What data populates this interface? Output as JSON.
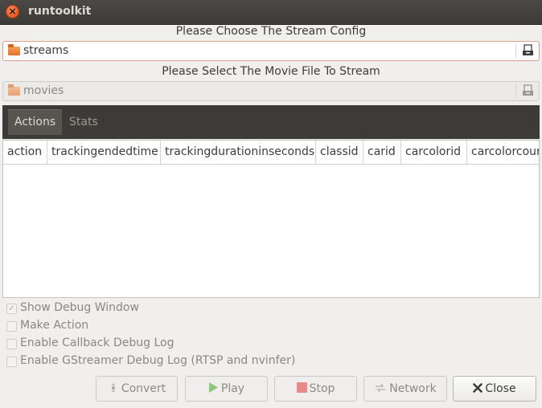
{
  "window": {
    "title": "runtoolkit",
    "close_glyph": "×"
  },
  "config": {
    "caption": "Please Choose The Stream Config",
    "chooser_label": "streams",
    "chooser_icon": "folder-icon",
    "action_icon": "document-open-icon"
  },
  "movie": {
    "caption": "Please Select The Movie File To Stream",
    "chooser_label": "movies",
    "chooser_icon": "folder-icon",
    "action_icon": "document-open-icon"
  },
  "tabs": [
    {
      "label": "Actions",
      "active": true
    },
    {
      "label": "Stats",
      "active": false
    }
  ],
  "table": {
    "columns": [
      "action",
      "trackingendedtime",
      "trackingdurationinseconds",
      "classid",
      "carid",
      "carcolorid",
      "carcolorcour"
    ],
    "rows": []
  },
  "options": [
    {
      "label": "Show Debug Window",
      "checked": true
    },
    {
      "label": "Make Action",
      "checked": false
    },
    {
      "label": "Enable Callback Debug Log",
      "checked": false
    },
    {
      "label": "Enable GStreamer Debug Log (RTSP and nvinfer)",
      "checked": false
    }
  ],
  "buttons": {
    "convert": {
      "label": "Convert",
      "icon": "convert-icon",
      "enabled": false
    },
    "play": {
      "label": "Play",
      "icon": "play-icon",
      "enabled": false
    },
    "stop": {
      "label": "Stop",
      "icon": "stop-icon",
      "enabled": false
    },
    "network": {
      "label": "Network",
      "icon": "network-icon",
      "enabled": false
    },
    "close": {
      "label": "Close",
      "icon": "close-icon",
      "enabled": true
    }
  },
  "colors": {
    "titlebar": "#3c3b37",
    "accent_close": "#df4a16",
    "tabbar": "#3c3b37",
    "stop_red": "#e04848",
    "play_green": "#5fb04a"
  }
}
